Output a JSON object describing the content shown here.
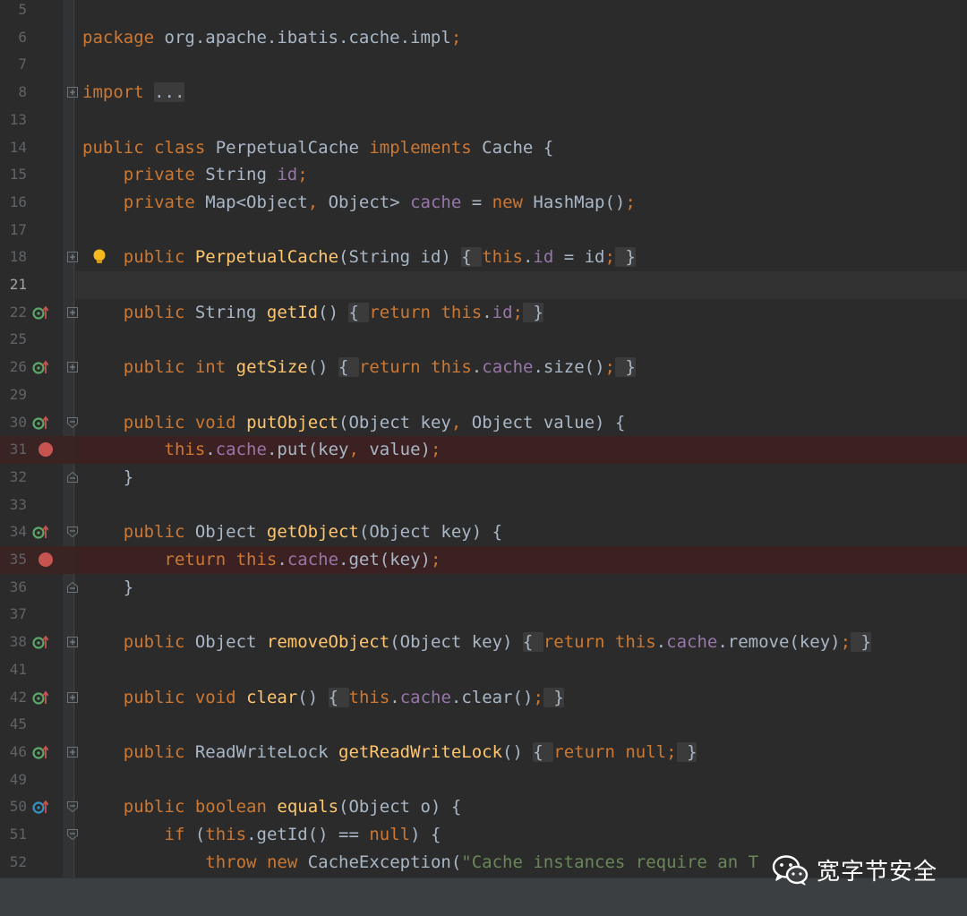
{
  "colors": {
    "background": "#2b2b2b",
    "keyword": "#cc7832",
    "field": "#9876aa",
    "method": "#ffc66d",
    "string": "#6a8759",
    "plain": "#a9b7c6",
    "line_number": "#606366",
    "breakpoint": "#c75450",
    "breakpoint_line": "#3b2121",
    "override_icon": "#59a869",
    "implements_icon": "#3592c4"
  },
  "editor": {
    "lines": [
      {
        "n": "5",
        "tokens": []
      },
      {
        "n": "6",
        "tokens": [
          [
            "package",
            "kw"
          ],
          [
            " org.apache.ibatis.cache.impl",
            "pl"
          ],
          [
            ";",
            "kw"
          ]
        ]
      },
      {
        "n": "7",
        "tokens": []
      },
      {
        "n": "8",
        "fold": "plus",
        "tokens": [
          [
            "import",
            "kw"
          ],
          [
            " ",
            "pl"
          ],
          [
            "...",
            "fb"
          ]
        ]
      },
      {
        "n": "13",
        "tokens": []
      },
      {
        "n": "14",
        "tokens": [
          [
            "public",
            "kw"
          ],
          [
            " ",
            "pl"
          ],
          [
            "class",
            "kw"
          ],
          [
            " PerpetualCache ",
            "pl"
          ],
          [
            "implements",
            "kw"
          ],
          [
            " Cache {",
            "pl"
          ]
        ]
      },
      {
        "n": "15",
        "tokens": [
          [
            "    ",
            "pl"
          ],
          [
            "private",
            "kw"
          ],
          [
            " String ",
            "pl"
          ],
          [
            "id",
            "fld"
          ],
          [
            ";",
            "kw"
          ]
        ]
      },
      {
        "n": "16",
        "tokens": [
          [
            "    ",
            "pl"
          ],
          [
            "private",
            "kw"
          ],
          [
            " Map<Object",
            "pl"
          ],
          [
            ",",
            "kw"
          ],
          [
            " Object> ",
            "pl"
          ],
          [
            "cache",
            "fld"
          ],
          [
            " = ",
            "pl"
          ],
          [
            "new",
            "kw"
          ],
          [
            " HashMap()",
            "pl"
          ],
          [
            ";",
            "kw"
          ]
        ]
      },
      {
        "n": "17",
        "tokens": []
      },
      {
        "n": "18",
        "fold": "plus",
        "bulb": true,
        "tokens": [
          [
            "    ",
            "pl"
          ],
          [
            "public",
            "kw"
          ],
          [
            " ",
            "pl"
          ],
          [
            "PerpetualCache",
            "fn"
          ],
          [
            "(String id) ",
            "pl"
          ],
          [
            "{ ",
            "fb"
          ],
          [
            "this",
            "kw"
          ],
          [
            ".",
            "pl"
          ],
          [
            "id",
            "fld"
          ],
          [
            " = id",
            "pl"
          ],
          [
            ";",
            "kw"
          ],
          [
            " }",
            "fb"
          ]
        ]
      },
      {
        "n": "21",
        "caret": true,
        "tokens": []
      },
      {
        "n": "22",
        "fold": "plus",
        "gutter": "override",
        "tokens": [
          [
            "    ",
            "pl"
          ],
          [
            "public",
            "kw"
          ],
          [
            " String ",
            "pl"
          ],
          [
            "getId",
            "fn"
          ],
          [
            "() ",
            "pl"
          ],
          [
            "{ ",
            "fb"
          ],
          [
            "return",
            "kw"
          ],
          [
            " ",
            "pl"
          ],
          [
            "this",
            "kw"
          ],
          [
            ".",
            "pl"
          ],
          [
            "id",
            "fld"
          ],
          [
            ";",
            "kw"
          ],
          [
            " }",
            "fb"
          ]
        ]
      },
      {
        "n": "25",
        "tokens": []
      },
      {
        "n": "26",
        "fold": "plus",
        "gutter": "override",
        "tokens": [
          [
            "    ",
            "pl"
          ],
          [
            "public",
            "kw"
          ],
          [
            " ",
            "pl"
          ],
          [
            "int",
            "kw"
          ],
          [
            " ",
            "pl"
          ],
          [
            "getSize",
            "fn"
          ],
          [
            "() ",
            "pl"
          ],
          [
            "{ ",
            "fb"
          ],
          [
            "return",
            "kw"
          ],
          [
            " ",
            "pl"
          ],
          [
            "this",
            "kw"
          ],
          [
            ".",
            "pl"
          ],
          [
            "cache",
            "fld"
          ],
          [
            ".size()",
            "pl"
          ],
          [
            ";",
            "kw"
          ],
          [
            " }",
            "fb"
          ]
        ]
      },
      {
        "n": "29",
        "tokens": []
      },
      {
        "n": "30",
        "fold": "open",
        "gutter": "override",
        "tokens": [
          [
            "    ",
            "pl"
          ],
          [
            "public",
            "kw"
          ],
          [
            " ",
            "pl"
          ],
          [
            "void",
            "kw"
          ],
          [
            " ",
            "pl"
          ],
          [
            "putObject",
            "fn"
          ],
          [
            "(Object key",
            "pl"
          ],
          [
            ",",
            "kw"
          ],
          [
            " Object value) {",
            "pl"
          ]
        ]
      },
      {
        "n": "31",
        "breakpoint": true,
        "tokens": [
          [
            "        ",
            "pl"
          ],
          [
            "this",
            "kw"
          ],
          [
            ".",
            "pl"
          ],
          [
            "cache",
            "fld"
          ],
          [
            ".put(key",
            "pl"
          ],
          [
            ",",
            "kw"
          ],
          [
            " value)",
            "pl"
          ],
          [
            ";",
            "kw"
          ]
        ]
      },
      {
        "n": "32",
        "fold": "close",
        "tokens": [
          [
            "    }",
            "pl"
          ]
        ]
      },
      {
        "n": "33",
        "tokens": []
      },
      {
        "n": "34",
        "fold": "open",
        "gutter": "override",
        "tokens": [
          [
            "    ",
            "pl"
          ],
          [
            "public",
            "kw"
          ],
          [
            " Object ",
            "pl"
          ],
          [
            "getObject",
            "fn"
          ],
          [
            "(Object key) {",
            "pl"
          ]
        ]
      },
      {
        "n": "35",
        "breakpoint": true,
        "tokens": [
          [
            "        ",
            "pl"
          ],
          [
            "return",
            "kw"
          ],
          [
            " ",
            "pl"
          ],
          [
            "this",
            "kw"
          ],
          [
            ".",
            "pl"
          ],
          [
            "cache",
            "fld"
          ],
          [
            ".get(key)",
            "pl"
          ],
          [
            ";",
            "kw"
          ]
        ]
      },
      {
        "n": "36",
        "fold": "close",
        "tokens": [
          [
            "    }",
            "pl"
          ]
        ]
      },
      {
        "n": "37",
        "tokens": []
      },
      {
        "n": "38",
        "fold": "plus",
        "gutter": "override",
        "tokens": [
          [
            "    ",
            "pl"
          ],
          [
            "public",
            "kw"
          ],
          [
            " Object ",
            "pl"
          ],
          [
            "removeObject",
            "fn"
          ],
          [
            "(Object key) ",
            "pl"
          ],
          [
            "{ ",
            "fb"
          ],
          [
            "return",
            "kw"
          ],
          [
            " ",
            "pl"
          ],
          [
            "this",
            "kw"
          ],
          [
            ".",
            "pl"
          ],
          [
            "cache",
            "fld"
          ],
          [
            ".remove(key)",
            "pl"
          ],
          [
            ";",
            "kw"
          ],
          [
            " }",
            "fb"
          ]
        ]
      },
      {
        "n": "41",
        "tokens": []
      },
      {
        "n": "42",
        "fold": "plus",
        "gutter": "override",
        "tokens": [
          [
            "    ",
            "pl"
          ],
          [
            "public",
            "kw"
          ],
          [
            " ",
            "pl"
          ],
          [
            "void",
            "kw"
          ],
          [
            " ",
            "pl"
          ],
          [
            "clear",
            "fn"
          ],
          [
            "() ",
            "pl"
          ],
          [
            "{ ",
            "fb"
          ],
          [
            "this",
            "kw"
          ],
          [
            ".",
            "pl"
          ],
          [
            "cache",
            "fld"
          ],
          [
            ".clear()",
            "pl"
          ],
          [
            ";",
            "kw"
          ],
          [
            " }",
            "fb"
          ]
        ]
      },
      {
        "n": "45",
        "tokens": []
      },
      {
        "n": "46",
        "fold": "plus",
        "gutter": "override",
        "tokens": [
          [
            "    ",
            "pl"
          ],
          [
            "public",
            "kw"
          ],
          [
            " ReadWriteLock ",
            "pl"
          ],
          [
            "getReadWriteLock",
            "fn"
          ],
          [
            "() ",
            "pl"
          ],
          [
            "{ ",
            "fb"
          ],
          [
            "return",
            "kw"
          ],
          [
            " ",
            "pl"
          ],
          [
            "null",
            "kw"
          ],
          [
            ";",
            "kw"
          ],
          [
            " }",
            "fb"
          ]
        ]
      },
      {
        "n": "49",
        "tokens": []
      },
      {
        "n": "50",
        "fold": "open",
        "gutter": "implements",
        "tokens": [
          [
            "    ",
            "pl"
          ],
          [
            "public",
            "kw"
          ],
          [
            " ",
            "pl"
          ],
          [
            "boolean",
            "kw"
          ],
          [
            " ",
            "pl"
          ],
          [
            "equals",
            "fn"
          ],
          [
            "(Object o) {",
            "pl"
          ]
        ]
      },
      {
        "n": "51",
        "fold": "open",
        "tokens": [
          [
            "        ",
            "pl"
          ],
          [
            "if",
            "kw"
          ],
          [
            " (",
            "pl"
          ],
          [
            "this",
            "kw"
          ],
          [
            ".getId() == ",
            "pl"
          ],
          [
            "null",
            "kw"
          ],
          [
            ") {",
            "pl"
          ]
        ]
      },
      {
        "n": "52",
        "tokens": [
          [
            "            ",
            "pl"
          ],
          [
            "throw",
            "kw"
          ],
          [
            " ",
            "pl"
          ],
          [
            "new",
            "kw"
          ],
          [
            " CacheException(",
            "pl"
          ],
          [
            "\"Cache instances require an T",
            "str"
          ]
        ]
      }
    ]
  },
  "watermark": {
    "icon": "wechat-icon",
    "text": "宽字节安全"
  }
}
